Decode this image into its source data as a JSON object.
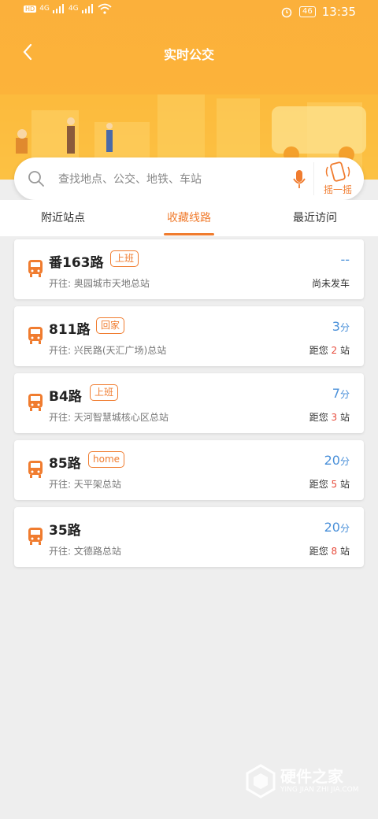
{
  "status_bar": {
    "left_badges": [
      "HD",
      "HD"
    ],
    "network": [
      "4G",
      "4G"
    ],
    "battery": "46",
    "time": "13:35"
  },
  "header": {
    "title": "实时公交",
    "back_icon": "chevron-left-icon"
  },
  "search": {
    "placeholder": "查找地点、公交、地铁、车站",
    "shake_label": "摇一摇"
  },
  "tabs": [
    {
      "label": "附近站点",
      "active": false
    },
    {
      "label": "收藏线路",
      "active": true
    },
    {
      "label": "最近访问",
      "active": false
    }
  ],
  "routes": [
    {
      "name": "番163路",
      "tag": "上班",
      "dest": "开往: 奥园城市天地总站",
      "eta": "--",
      "eta_unit": "",
      "status": "尚未发车",
      "stops_prefix": "",
      "stops_num": "",
      "stops_suffix": ""
    },
    {
      "name": "811路",
      "tag": "回家",
      "dest": "开往: 兴民路(天汇广场)总站",
      "eta": "3",
      "eta_unit": "分",
      "status": "",
      "stops_prefix": "距您 ",
      "stops_num": "2",
      "stops_suffix": " 站"
    },
    {
      "name": "B4路",
      "tag": "上班",
      "dest": "开往: 天河智慧城核心区总站",
      "eta": "7",
      "eta_unit": "分",
      "status": "",
      "stops_prefix": "距您 ",
      "stops_num": "3",
      "stops_suffix": " 站"
    },
    {
      "name": "85路",
      "tag": "home",
      "dest": "开往: 天平架总站",
      "eta": "20",
      "eta_unit": "分",
      "status": "",
      "stops_prefix": "距您 ",
      "stops_num": "5",
      "stops_suffix": " 站"
    },
    {
      "name": "35路",
      "tag": "",
      "dest": "开往: 文德路总站",
      "eta": "20",
      "eta_unit": "分",
      "status": "",
      "stops_prefix": "距您 ",
      "stops_num": "8",
      "stops_suffix": " 站"
    }
  ],
  "watermark": {
    "text": "硬件之家",
    "sub": "YING JIAN ZHI JIA.COM"
  },
  "colors": {
    "accent": "#f07c2f",
    "eta_blue": "#4a90d9",
    "header_yellow": "#fbb03b"
  }
}
